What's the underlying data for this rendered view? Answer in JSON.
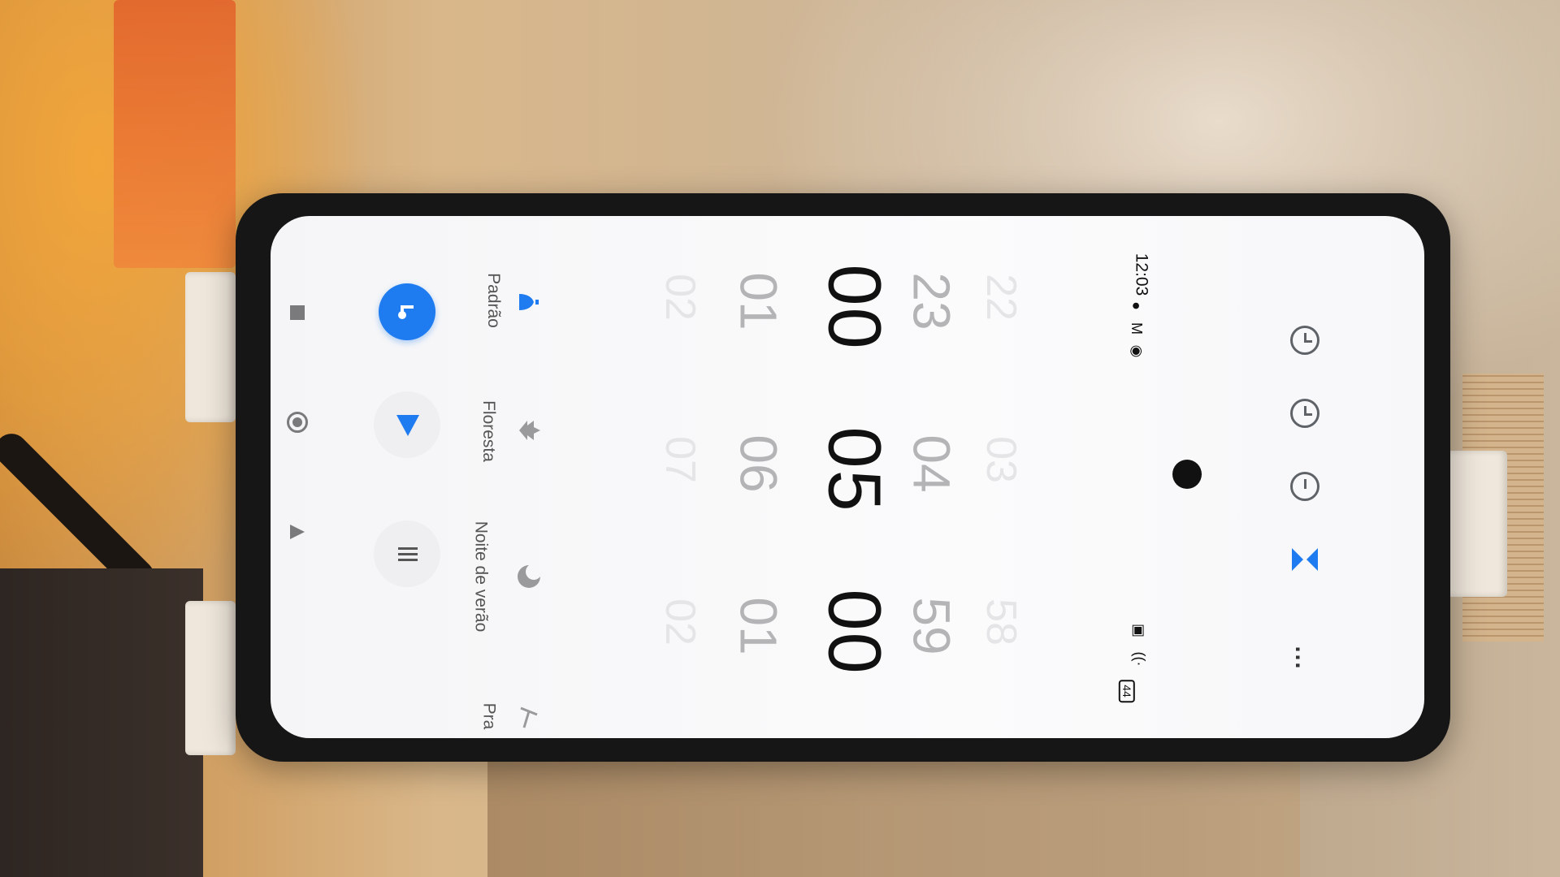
{
  "status_bar": {
    "time": "12:03",
    "battery": "44"
  },
  "tabs": [
    {
      "name": "alarm",
      "icon": "alarm-icon"
    },
    {
      "name": "clock",
      "icon": "clock-icon"
    },
    {
      "name": "stopwatch",
      "icon": "stopwatch-icon"
    },
    {
      "name": "timer",
      "icon": "hourglass-icon",
      "active": true
    }
  ],
  "menu_icon": "more-vertical-icon",
  "picker": {
    "hours": {
      "far_prev": "22",
      "prev": "23",
      "current": "00",
      "next": "01",
      "far_next": "02"
    },
    "minutes": {
      "far_prev": "03",
      "prev": "04",
      "current": "05",
      "next": "06",
      "far_next": "07"
    },
    "seconds": {
      "far_prev": "58",
      "prev": "59",
      "current": "00",
      "next": "01",
      "far_next": "02"
    }
  },
  "presets": [
    {
      "label": "Padrão",
      "icon": "bell-icon",
      "selected": true
    },
    {
      "label": "Floresta",
      "icon": "tree-icon"
    },
    {
      "label": "Noite de verão",
      "icon": "moon-icon"
    },
    {
      "label": "Pra",
      "icon": "beach-icon"
    }
  ],
  "actions": {
    "sound_icon": "music-note-icon",
    "start_icon": "play-icon",
    "reset_icon": "pause-bars-icon"
  },
  "navigation": {
    "recents_icon": "square-icon",
    "home_icon": "circle-icon",
    "back_icon": "triangle-icon"
  },
  "colors": {
    "accent": "#1e7cf0",
    "screen_bg": "#f7f7f9",
    "text_primary": "#111111"
  }
}
